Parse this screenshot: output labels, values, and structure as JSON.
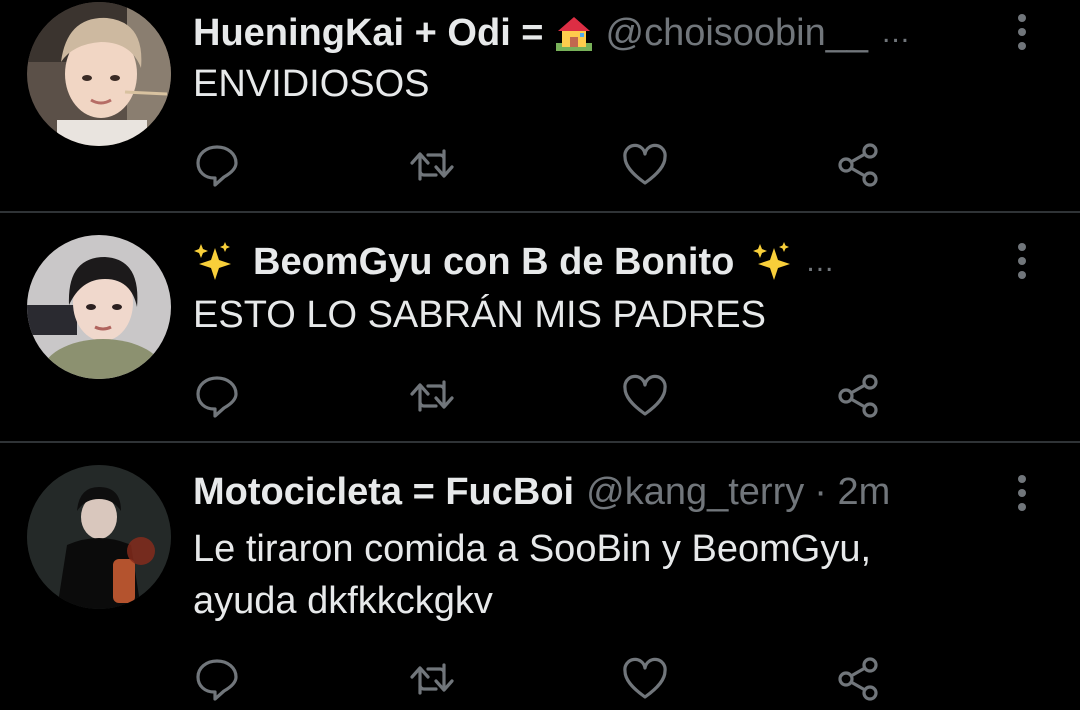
{
  "tweets": [
    {
      "display_name": "HueningKai + Odi =",
      "name_emoji": "house-with-garden-emoji",
      "handle": "@choisoobin__",
      "ellipsis": "...",
      "text": "ENVIDIOSOS",
      "avatar": "profile-photo-light"
    },
    {
      "display_name": "BeomGyu con B de Bonito",
      "name_emoji": "sparkles-emoji",
      "handle": "",
      "ellipsis": "...",
      "text": "ESTO LO SABRÁN MIS PADRES",
      "avatar": "profile-photo-gray"
    },
    {
      "display_name": "Motocicleta = FucBoi",
      "handle": "@kang_terry",
      "time": "· 2m",
      "text_line1": "Le tiraron comida a SooBin y BeomGyu,",
      "text_line2": "ayuda dkfkkckgkv",
      "avatar": "profile-photo-dark"
    }
  ],
  "actions": [
    "reply-icon",
    "retweet-icon",
    "like-icon",
    "share-icon"
  ],
  "colors": {
    "background": "#000000",
    "text": "#e7e9ea",
    "secondary": "#71767b",
    "divider": "#2f3336",
    "sparkle": "#f8cf3a"
  }
}
